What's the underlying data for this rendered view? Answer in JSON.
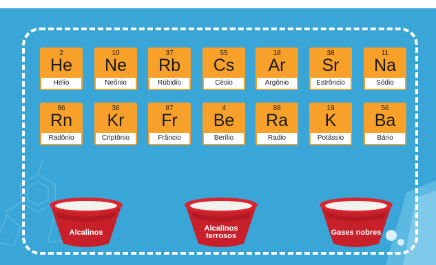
{
  "colors": {
    "background": "#3aa6d7",
    "card": "#f7a02a",
    "bowl": "#c8202a"
  },
  "elements": [
    {
      "number": "2",
      "symbol": "He",
      "name": "Hélio"
    },
    {
      "number": "10",
      "symbol": "Ne",
      "name": "Neônio"
    },
    {
      "number": "37",
      "symbol": "Rb",
      "name": "Rúbidio"
    },
    {
      "number": "55",
      "symbol": "Cs",
      "name": "Césio"
    },
    {
      "number": "18",
      "symbol": "Ar",
      "name": "Argônio"
    },
    {
      "number": "38",
      "symbol": "Sr",
      "name": "Estrôncio"
    },
    {
      "number": "11",
      "symbol": "Na",
      "name": "Sódio"
    },
    {
      "number": "86",
      "symbol": "Rn",
      "name": "Radônio"
    },
    {
      "number": "36",
      "symbol": "Kr",
      "name": "Criptônio"
    },
    {
      "number": "87",
      "symbol": "Fr",
      "name": "Frâncio"
    },
    {
      "number": "4",
      "symbol": "Be",
      "name": "Berílio"
    },
    {
      "number": "88",
      "symbol": "Ra",
      "name": "Radio"
    },
    {
      "number": "19",
      "symbol": "K",
      "name": "Potássio"
    },
    {
      "number": "56",
      "symbol": "Ba",
      "name": "Bário"
    }
  ],
  "bowls": [
    {
      "label": "Alcalinos"
    },
    {
      "label": "Alcalinos terrosos"
    },
    {
      "label": "Gases nobres"
    }
  ]
}
